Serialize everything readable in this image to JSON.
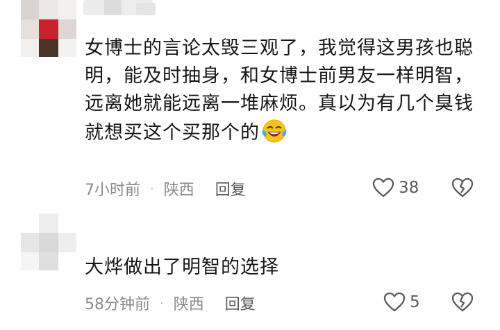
{
  "comments": [
    {
      "text": "女博士的言论太毁三观了，我觉得这男孩也聪明，能及时抽身，和女博士前男友一样明智，远离她就能远离一堆麻烦。真以为有几个臭钱就想买这个买那个的",
      "emoji": "crying-laughing-emoji",
      "time": "7小时前",
      "location": "陕西",
      "reply_label": "回复",
      "like_count": "38"
    },
    {
      "text": "大烨做出了明智的选择",
      "time": "58分钟前",
      "location": "陕西",
      "reply_label": "回复",
      "like_count": "5"
    }
  ],
  "separator": "·",
  "colors": {
    "text": "#161616",
    "meta": "#8a8a8a",
    "icon": "#5a5a5a",
    "emoji_face": "#f5c518",
    "emoji_tears": "#4aa8e8"
  }
}
